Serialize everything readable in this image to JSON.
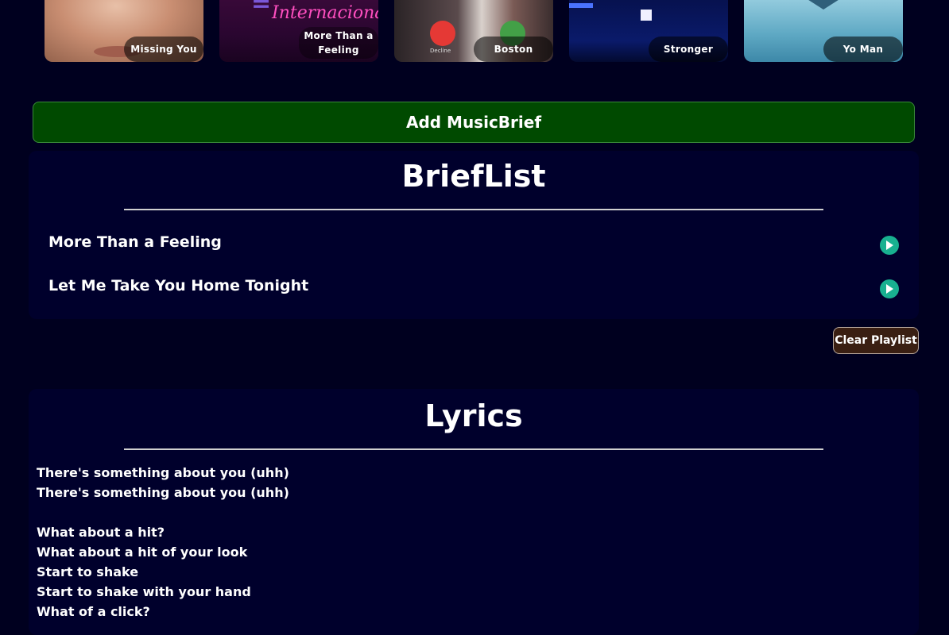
{
  "carousel": [
    {
      "label": "Missing You"
    },
    {
      "label": "More Than a Feeling"
    },
    {
      "label": "Boston"
    },
    {
      "label": "Stronger"
    },
    {
      "label": "Yo Man"
    }
  ],
  "art_text": {
    "neon": "Internacional",
    "decline": "Decline"
  },
  "add_button_label": "Add MusicBrief",
  "brieflist": {
    "title": "BriefList",
    "items": [
      "More Than a Feeling",
      "Let Me Take You Home Tonight"
    ]
  },
  "clear_button_label": "Clear Playlist",
  "lyrics": {
    "title": "Lyrics",
    "lines": [
      "There's something about you (uhh)",
      "There's something about you (uhh)",
      "",
      "What about a hit?",
      "What about a hit of your look",
      "Start to shake",
      "Start to shake with your hand",
      "What of a click?"
    ]
  },
  "colors": {
    "background": "#00001f",
    "panel": "#00002c",
    "add_button": "#004a00",
    "play_button": "#18b090",
    "clear_button": "#3a1f12"
  },
  "icons": {
    "play": "play-icon"
  }
}
